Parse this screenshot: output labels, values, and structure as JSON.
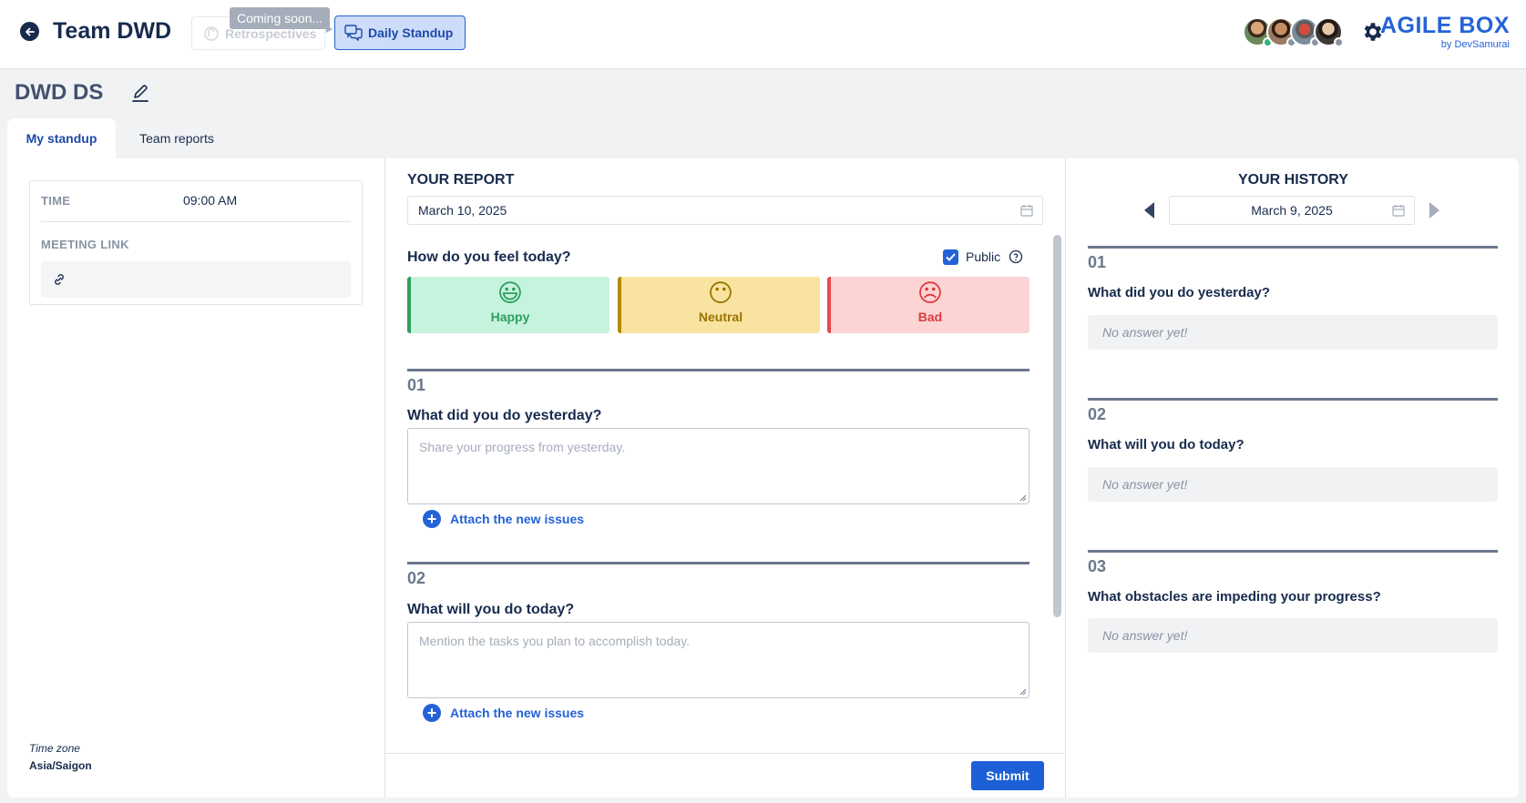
{
  "header": {
    "back_icon": "arrow-left-icon",
    "team_name": "Team DWD",
    "retro_label": "Retrospectives",
    "retro_tooltip": "Coming soon...",
    "standup_label": "Daily Standup",
    "brand_title": "AGILE BOX",
    "brand_sub": "by DevSamurai",
    "accent": "#2462d8"
  },
  "board": {
    "title": "DWD DS"
  },
  "tabs": [
    {
      "label": "My standup",
      "active": true
    },
    {
      "label": "Team reports",
      "active": false
    }
  ],
  "meeting": {
    "time_label": "TIME",
    "time_value": "09:00 AM",
    "link_label": "MEETING LINK",
    "timezone_label": "Time zone",
    "timezone_value": "Asia/Saigon"
  },
  "report": {
    "title": "YOUR REPORT",
    "date": "March 10, 2025",
    "feel_label": "How do you feel today?",
    "public_label": "Public",
    "public_checked": true,
    "moods": [
      {
        "label": "Happy",
        "emoji": "😃"
      },
      {
        "label": "Neutral",
        "emoji": "😶"
      },
      {
        "label": "Bad",
        "emoji": "☹"
      }
    ],
    "questions": [
      {
        "num": "01",
        "text": "What did you do yesterday?",
        "placeholder": "Share your progress from yesterday."
      },
      {
        "num": "02",
        "text": "What will you do today?",
        "placeholder": "Mention the tasks you plan to accomplish today."
      }
    ],
    "attach_label": "Attach the new issues",
    "submit_label": "Submit"
  },
  "history": {
    "title": "YOUR HISTORY",
    "date": "March 9, 2025",
    "items": [
      {
        "num": "01",
        "text": "What did you do yesterday?",
        "answer": "No answer yet!"
      },
      {
        "num": "02",
        "text": "What will you do today?",
        "answer": "No answer yet!"
      },
      {
        "num": "03",
        "text": "What obstacles are impeding your progress?",
        "answer": "No answer yet!"
      }
    ]
  }
}
